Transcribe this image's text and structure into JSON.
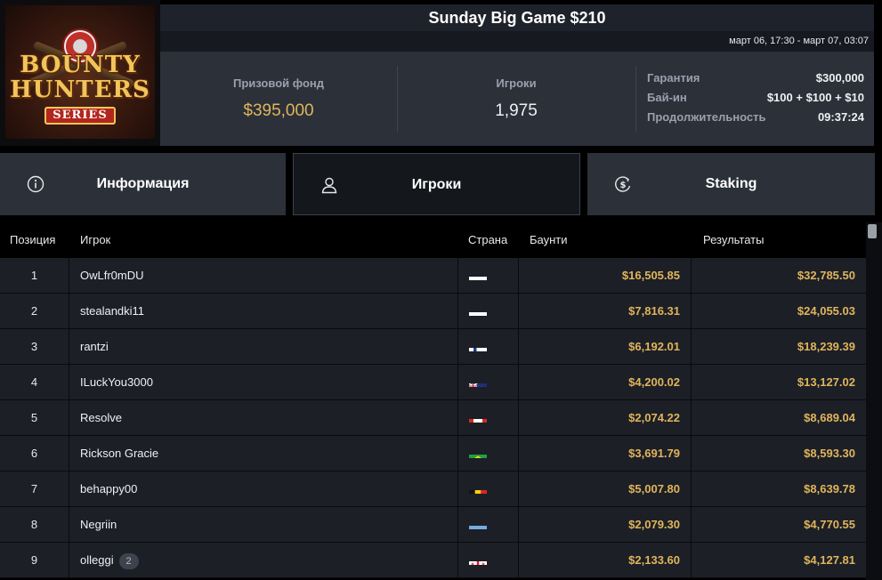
{
  "logo": {
    "line1": "BOUNTY",
    "line2": "HUNTERS",
    "series": "SERIES"
  },
  "tournament": {
    "title": "Sunday Big Game $210",
    "dates": "март 06, 17:30 - март 07, 03:07"
  },
  "stats": {
    "prize_label": "Призовой фонд",
    "prize_value": "$395,000",
    "players_label": "Игроки",
    "players_value": "1,975",
    "guarantee_label": "Гарантия",
    "guarantee_value": "$300,000",
    "buyin_label": "Бай-ин",
    "buyin_value": "$100 + $100 + $10",
    "duration_label": "Продолжительность",
    "duration_value": "09:37:24"
  },
  "tabs": [
    {
      "label": "Информация",
      "icon": "info-icon"
    },
    {
      "label": "Игроки",
      "icon": "user-icon",
      "active": true
    },
    {
      "label": "Staking",
      "icon": "dollar-coin-icon"
    }
  ],
  "table": {
    "headers": {
      "position": "Позиция",
      "player": "Игрок",
      "country": "Страна",
      "bounty": "Баунти",
      "results": "Результаты"
    },
    "rows": [
      {
        "pos": "1",
        "player": "OwLfr0mDU",
        "flag": "russia",
        "bounty": "$16,505.85",
        "result": "$32,785.50",
        "badge": ""
      },
      {
        "pos": "2",
        "player": "stealandki11",
        "flag": "russia",
        "bounty": "$7,816.31",
        "result": "$24,055.03",
        "badge": ""
      },
      {
        "pos": "3",
        "player": "rantzi",
        "flag": "finland",
        "bounty": "$6,192.01",
        "result": "$18,239.39",
        "badge": ""
      },
      {
        "pos": "4",
        "player": "ILuckYou3000",
        "flag": "new-zealand",
        "bounty": "$4,200.02",
        "result": "$13,127.02",
        "badge": ""
      },
      {
        "pos": "5",
        "player": "Resolve",
        "flag": "canada",
        "bounty": "$2,074.22",
        "result": "$8,689.04",
        "badge": ""
      },
      {
        "pos": "6",
        "player": "Rickson Gracie",
        "flag": "brazil",
        "bounty": "$3,691.79",
        "result": "$8,593.30",
        "badge": ""
      },
      {
        "pos": "7",
        "player": "behappy00",
        "flag": "belgium",
        "bounty": "$5,007.80",
        "result": "$8,639.78",
        "badge": ""
      },
      {
        "pos": "8",
        "player": "Negriin",
        "flag": "argentina",
        "bounty": "$2,079.30",
        "result": "$4,770.55",
        "badge": ""
      },
      {
        "pos": "9",
        "player": "olleggi",
        "flag": "georgia",
        "bounty": "$2,133.60",
        "result": "$4,127.81",
        "badge": "2"
      }
    ]
  },
  "colors": {
    "accent_gold": "#e0b55c",
    "panel": "#2b3039",
    "row": "#1c1f26"
  }
}
